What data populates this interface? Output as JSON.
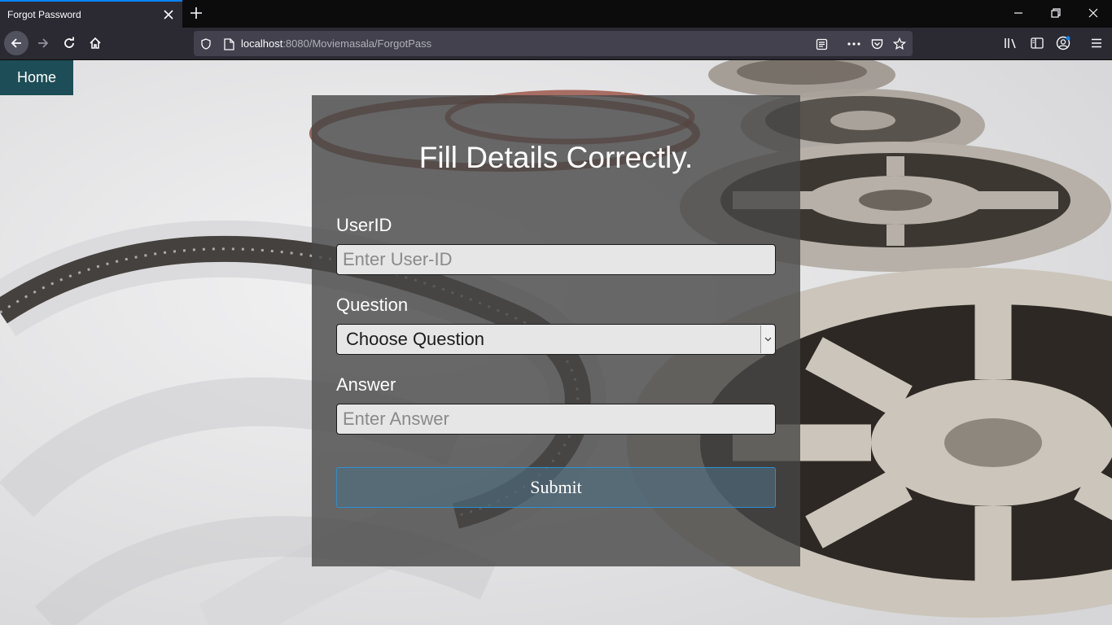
{
  "browser": {
    "tab_title": "Forgot Password",
    "url_host": "localhost",
    "url_rest": ":8080/Moviemasala/ForgotPass"
  },
  "page": {
    "home_label": "Home",
    "heading": "Fill Details Correctly.",
    "userid_label": "UserID",
    "userid_placeholder": "Enter User-ID",
    "question_label": "Question",
    "question_selected": "Choose Question",
    "answer_label": "Answer",
    "answer_placeholder": "Enter Answer",
    "submit_label": "Submit"
  },
  "colors": {
    "accent": "#0a84ff",
    "home_bg": "#1d4d56",
    "panel_bg": "#464646",
    "submit_border": "#2d8fd0"
  }
}
